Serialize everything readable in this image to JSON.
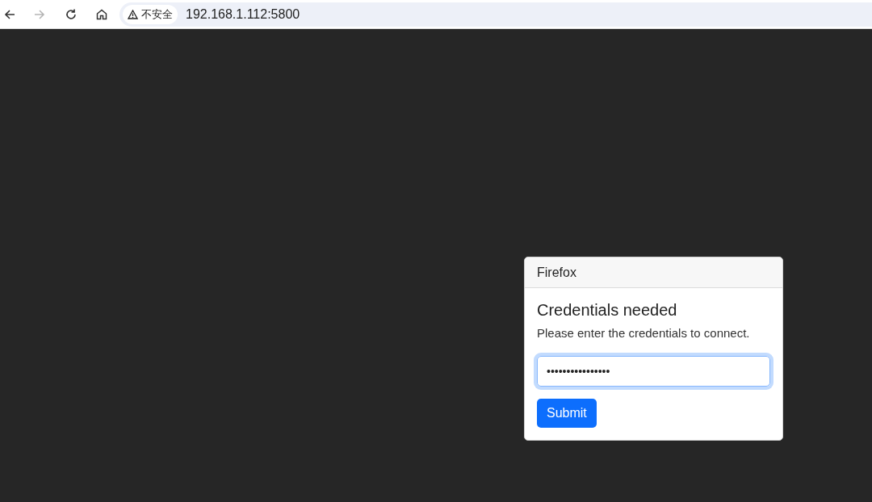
{
  "browser": {
    "security_label": "不安全",
    "url": "192.168.1.112:5800",
    "forward_disabled": true
  },
  "dialog": {
    "title": "Firefox",
    "heading": "Credentials needed",
    "message": "Please enter the credentials to connect.",
    "password": {
      "value": "••••••••••••••••",
      "focused": true
    },
    "submit": "Submit"
  }
}
